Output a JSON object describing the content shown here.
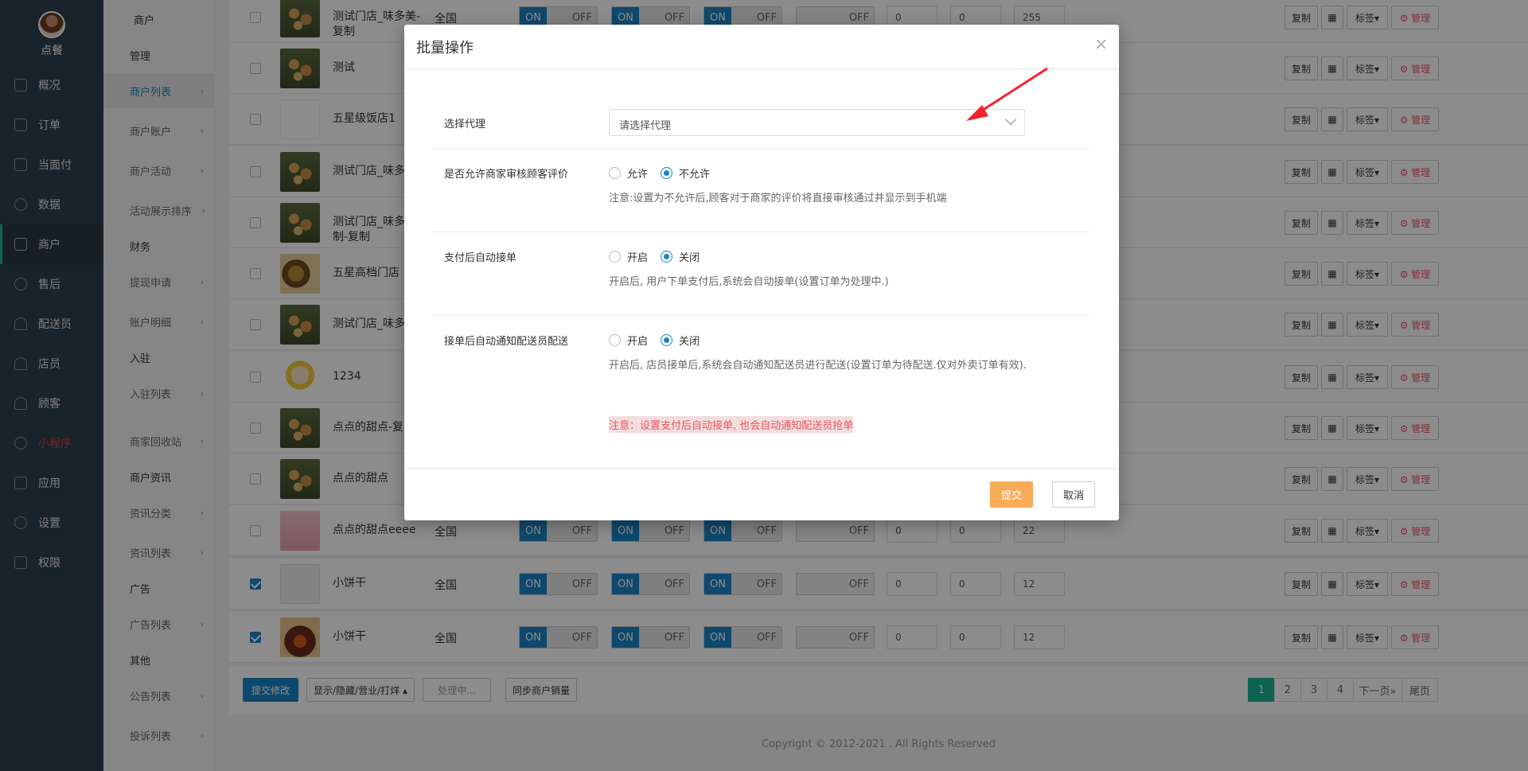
{
  "sidebar": {
    "brand": "点餐",
    "items": [
      {
        "label": "概况",
        "icon": "dashboard-icon"
      },
      {
        "label": "订单",
        "icon": "order-icon"
      },
      {
        "label": "当面付",
        "icon": "pay-icon"
      },
      {
        "label": "数据",
        "icon": "data-icon"
      },
      {
        "label": "商户",
        "icon": "store-icon"
      },
      {
        "label": "售后",
        "icon": "aftersale-icon"
      },
      {
        "label": "配送员",
        "icon": "courier-icon"
      },
      {
        "label": "店员",
        "icon": "staff-icon"
      },
      {
        "label": "顾客",
        "icon": "customer-icon"
      },
      {
        "label": "小程序",
        "icon": "miniapp-icon"
      },
      {
        "label": "应用",
        "icon": "apps-icon"
      },
      {
        "label": "设置",
        "icon": "gear-icon"
      },
      {
        "label": "权限",
        "icon": "lock-icon"
      }
    ]
  },
  "subnav": {
    "items": [
      {
        "label": "商户"
      },
      {
        "label": "管理"
      },
      {
        "label": "商户列表"
      },
      {
        "label": "商户账户"
      },
      {
        "label": "商户活动"
      },
      {
        "label": "活动展示排序"
      },
      {
        "label": "财务"
      },
      {
        "label": "提现申请"
      },
      {
        "label": "账户明细"
      },
      {
        "label": "入驻"
      },
      {
        "label": "入驻列表"
      },
      {
        "label": "商家回收站"
      },
      {
        "label": "商户资讯"
      },
      {
        "label": "资讯分类"
      },
      {
        "label": "资讯列表"
      },
      {
        "label": "广告"
      },
      {
        "label": "广告列表"
      },
      {
        "label": "其他"
      },
      {
        "label": "公告列表"
      },
      {
        "label": "投诉列表"
      }
    ]
  },
  "table": {
    "on_label": "ON",
    "off_label": "OFF",
    "actions": {
      "copy": "复制",
      "qr": "▦",
      "tag": "标签▾",
      "manage": "⚙ 管理"
    },
    "rows": [
      {
        "name": "测试门店_味多美-复制",
        "region": "全国",
        "v1": "0",
        "v2": "0",
        "v3": "255"
      },
      {
        "name": "测试"
      },
      {
        "name": "五星级饭店1"
      },
      {
        "name": "测试门店_味多"
      },
      {
        "name": "测试门店_味多复制-复制"
      },
      {
        "name": "五星高档门店"
      },
      {
        "name": "测试门店_味多复制"
      },
      {
        "name": "1234"
      },
      {
        "name": "点点的甜点-复"
      },
      {
        "name": "点点的甜点"
      },
      {
        "name": "点点的甜点eeee",
        "region": "全国",
        "v1": "0",
        "v2": "0",
        "v3": "22"
      },
      {
        "name": "小饼干",
        "region": "全国",
        "v1": "0",
        "v2": "0",
        "v3": "12"
      },
      {
        "name": "小饼干",
        "region": "全国",
        "v1": "0",
        "v2": "0",
        "v3": "12"
      }
    ]
  },
  "footer": {
    "submit_edit": "提交修改",
    "display_toggle": "显示/隐藏/营业/打烊 ▴",
    "processing": "处理中...",
    "sync_sales": "同步商户销量",
    "pages": [
      "1",
      "2",
      "3",
      "4"
    ],
    "next": "下一页»",
    "last": "尾页",
    "copyright": "Copyright © 2012-2021 . All Rights Reserved"
  },
  "modal": {
    "title": "批量操作",
    "close": "×",
    "agent_label": "选择代理",
    "agent_placeholder": "请选择代理",
    "review_label": "是否允许商家审核顾客评价",
    "review_opt1": "允许",
    "review_opt2": "不允许",
    "review_help": "注意:设置为不允许后,顾客对于商家的评价将直接审核通过并显示到手机端",
    "autoaccept_label": "支付后自动接单",
    "autoaccept_opt1": "开启",
    "autoaccept_opt2": "关闭",
    "autoaccept_help": "开启后, 用户下单支付后,系统会自动接单(设置订单为处理中.)",
    "notify_label": "接单后自动通知配送员配送",
    "notify_opt1": "开启",
    "notify_opt2": "关闭",
    "notify_help": "开启后, 店员接单后,系统会自动通知配送员进行配送(设置订单为待配送.仅对外卖订单有效).",
    "notify_warn": "注意：设置支付后自动接单, 也会自动通知配送员抢单",
    "submit": "提交",
    "cancel": "取消"
  },
  "colors": {
    "sidebar": "#2f4050",
    "accent": "#1c84c6",
    "warning": "#f8ac59",
    "danger": "#ed5565",
    "arrow": "#f5222d"
  }
}
